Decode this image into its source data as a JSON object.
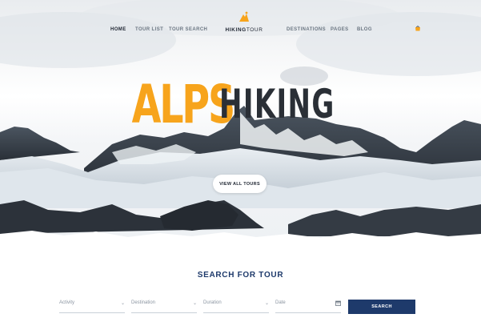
{
  "brand": {
    "name_bold": "HIKING",
    "name_light": "TOUR",
    "accent_color": "#f7a41c",
    "primary_color": "#1e3a6b"
  },
  "nav": {
    "left": [
      {
        "label": "HOME",
        "active": true
      },
      {
        "label": "TOUR LIST",
        "active": false
      },
      {
        "label": "TOUR SEARCH",
        "active": false
      }
    ],
    "right": [
      {
        "label": "DESTINATIONS",
        "active": false
      },
      {
        "label": "PAGES",
        "active": false
      },
      {
        "label": "BLOG",
        "active": false
      }
    ],
    "cart_icon": "cart-icon"
  },
  "hero": {
    "title_accent": "ALPS",
    "title_main": "HIKING",
    "cta_label": "VIEW ALL TOURS"
  },
  "search": {
    "title": "SEARCH FOR TOUR",
    "fields": [
      {
        "label": "Activity",
        "icon": "chevron-down-icon"
      },
      {
        "label": "Destination",
        "icon": "chevron-down-icon"
      },
      {
        "label": "Duration",
        "icon": "chevron-down-icon"
      },
      {
        "label": "Date",
        "icon": "calendar-icon"
      }
    ],
    "button_label": "SEARCH"
  }
}
